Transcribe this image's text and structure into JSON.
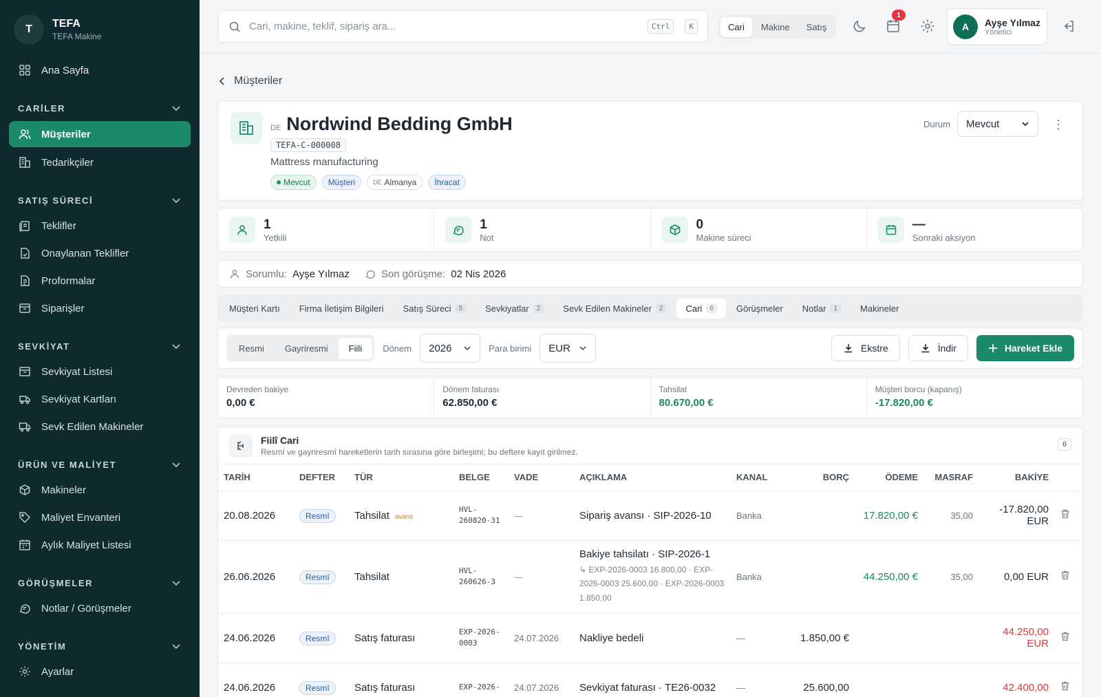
{
  "brand": {
    "logo_letter": "T",
    "name": "TEFA",
    "subtitle": "TEFA Makine"
  },
  "sidebar": {
    "home": "Ana Sayfa",
    "sections": [
      {
        "title": "CARİLER",
        "items": [
          "Müşteriler",
          "Tedarikçiler"
        ]
      },
      {
        "title": "SATIŞ SÜRECİ",
        "items": [
          "Teklifler",
          "Onaylanan Teklifler",
          "Proformalar",
          "Siparişler"
        ]
      },
      {
        "title": "SEVKİYAT",
        "items": [
          "Sevkiyat Listesi",
          "Sevkiyat Kartları",
          "Sevk Edilen Makineler"
        ]
      },
      {
        "title": "ÜRÜN VE MALİYET",
        "items": [
          "Makineler",
          "Maliyet Envanteri",
          "Aylık Maliyet Listesi"
        ]
      },
      {
        "title": "GÖRÜŞMELER",
        "items": [
          "Notlar / Görüşmeler"
        ]
      },
      {
        "title": "YÖNETİM",
        "items": [
          "Ayarlar"
        ]
      }
    ],
    "active_item": "Müşteriler"
  },
  "topbar": {
    "search_placeholder": "Cari, makine, teklif, sipariş ara...",
    "kbd_ctrl": "Ctrl",
    "kbd_k": "K",
    "scope": [
      "Cari",
      "Makine",
      "Satış"
    ],
    "scope_selected": "Cari",
    "notification_count": "1",
    "user": {
      "initial": "A",
      "name": "Ayşe Yılmaz",
      "role": "Yönetici"
    }
  },
  "breadcrumb": {
    "back_label": "Müşteriler"
  },
  "customer": {
    "country_code": "DE",
    "name": "Nordwind Bedding GmbH",
    "code": "TEFA-C-000008",
    "sector": "Mattress manufacturing",
    "tags": {
      "status": "Mevcut",
      "type": "Müşteri",
      "country_code": "DE",
      "country": "Almanya",
      "trade": "İhracat"
    },
    "status_label": "Durum",
    "status_value": "Mevcut"
  },
  "stats": [
    {
      "value": "1",
      "label": "Yetkili"
    },
    {
      "value": "1",
      "label": "Not"
    },
    {
      "value": "0",
      "label": "Makine süreci"
    },
    {
      "value": "—",
      "label": "Sonraki aksiyon"
    }
  ],
  "responsible": {
    "label": "Sorumlu:",
    "name": "Ayşe Yılmaz",
    "last_meeting_label": "Son görüşme:",
    "last_meeting": "02 Nis 2026"
  },
  "tabs": [
    {
      "label": "Müşteri Kartı",
      "count": ""
    },
    {
      "label": "Firma İletişim Bilgileri",
      "count": ""
    },
    {
      "label": "Satış Süreci",
      "count": "5"
    },
    {
      "label": "Sevkiyatlar",
      "count": "2"
    },
    {
      "label": "Sevk Edilen Makineler",
      "count": "2"
    },
    {
      "label": "Cari",
      "count": "6"
    },
    {
      "label": "Görüşmeler",
      "count": ""
    },
    {
      "label": "Notlar",
      "count": "1"
    },
    {
      "label": "Makineler",
      "count": ""
    }
  ],
  "active_tab": "Cari",
  "filters": {
    "ledger_types": [
      "Resmi",
      "Gayriresmi",
      "Fiili"
    ],
    "ledger_selected": "Fiili",
    "period_label": "Dönem",
    "period": "2026",
    "currency_label": "Para birimi",
    "currency": "EUR",
    "ekstre": "Ekstre",
    "indir": "İndir",
    "add": "Hareket Ekle"
  },
  "balances": [
    {
      "label": "Devreden bakiye",
      "value": "0,00 €"
    },
    {
      "label": "Dönem faturası",
      "value": "62.850,00 €"
    },
    {
      "label": "Tahsilat",
      "value": "80.670,00 €"
    },
    {
      "label": "Müşteri borcu (kapanış)",
      "value": "-17.820,00 €"
    }
  ],
  "ledger": {
    "title": "Fiilî Cari",
    "subtitle": "Resmî ve gayriresmî hareketlerin tarih sırasına göre birleşimi; bu deftere kayıt girilmez.",
    "count": "6",
    "columns": [
      "TARİH",
      "DEFTER",
      "TÜR",
      "BELGE",
      "VADE",
      "AÇIKLAMA",
      "KANAL",
      "BORÇ",
      "ÖDEME",
      "MASRAF",
      "BAKİYE"
    ],
    "rows": [
      {
        "date": "20.08.2026",
        "book": "Resmî",
        "type": "Tahsilat",
        "type_tag": "avans",
        "doc": "HVL-260820-31",
        "due": "—",
        "desc": "Sipariş avansı · SIP-2026-10",
        "desc_sub": "",
        "channel": "Banka",
        "debit": "",
        "payment": "17.820,00 €",
        "expense": "35,00",
        "balance": "-17.820,00 EUR"
      },
      {
        "date": "26.06.2026",
        "book": "Resmî",
        "type": "Tahsilat",
        "type_tag": "",
        "doc": "HVL-260626-3",
        "due": "—",
        "desc": "Bakiye tahsilatı · SIP-2026-1",
        "desc_sub": "↳ EXP-2026-0003 16.800,00 · EXP-2026-0003 25.600,00 · EXP-2026-0003 1.850,00",
        "channel": "Banka",
        "debit": "",
        "payment": "44.250,00 €",
        "expense": "35,00",
        "balance": "0,00 EUR"
      },
      {
        "date": "24.06.2026",
        "book": "Resmî",
        "type": "Satış faturası",
        "type_tag": "",
        "doc": "EXP-2026-0003",
        "due": "24.07.2026",
        "desc": "Nakliye bedeli",
        "desc_sub": "",
        "channel": "—",
        "debit": "1.850,00 €",
        "payment": "",
        "expense": "",
        "balance": "44.250,00 EUR"
      },
      {
        "date": "24.06.2026",
        "book": "Resmî",
        "type": "Satış faturası",
        "type_tag": "",
        "doc": "EXP-2026-",
        "due": "24.07.2026",
        "desc": "Sevkiyat faturası · TE26-0032",
        "desc_sub": "",
        "channel": "—",
        "debit": "25.600,00",
        "payment": "",
        "expense": "",
        "balance": "42.400,00"
      }
    ]
  },
  "colors": {
    "sidebar_bg": "#0f2a2f",
    "accent": "#1a8a6b",
    "positive": "#1a8a5c",
    "negative": "#d63a3a"
  }
}
